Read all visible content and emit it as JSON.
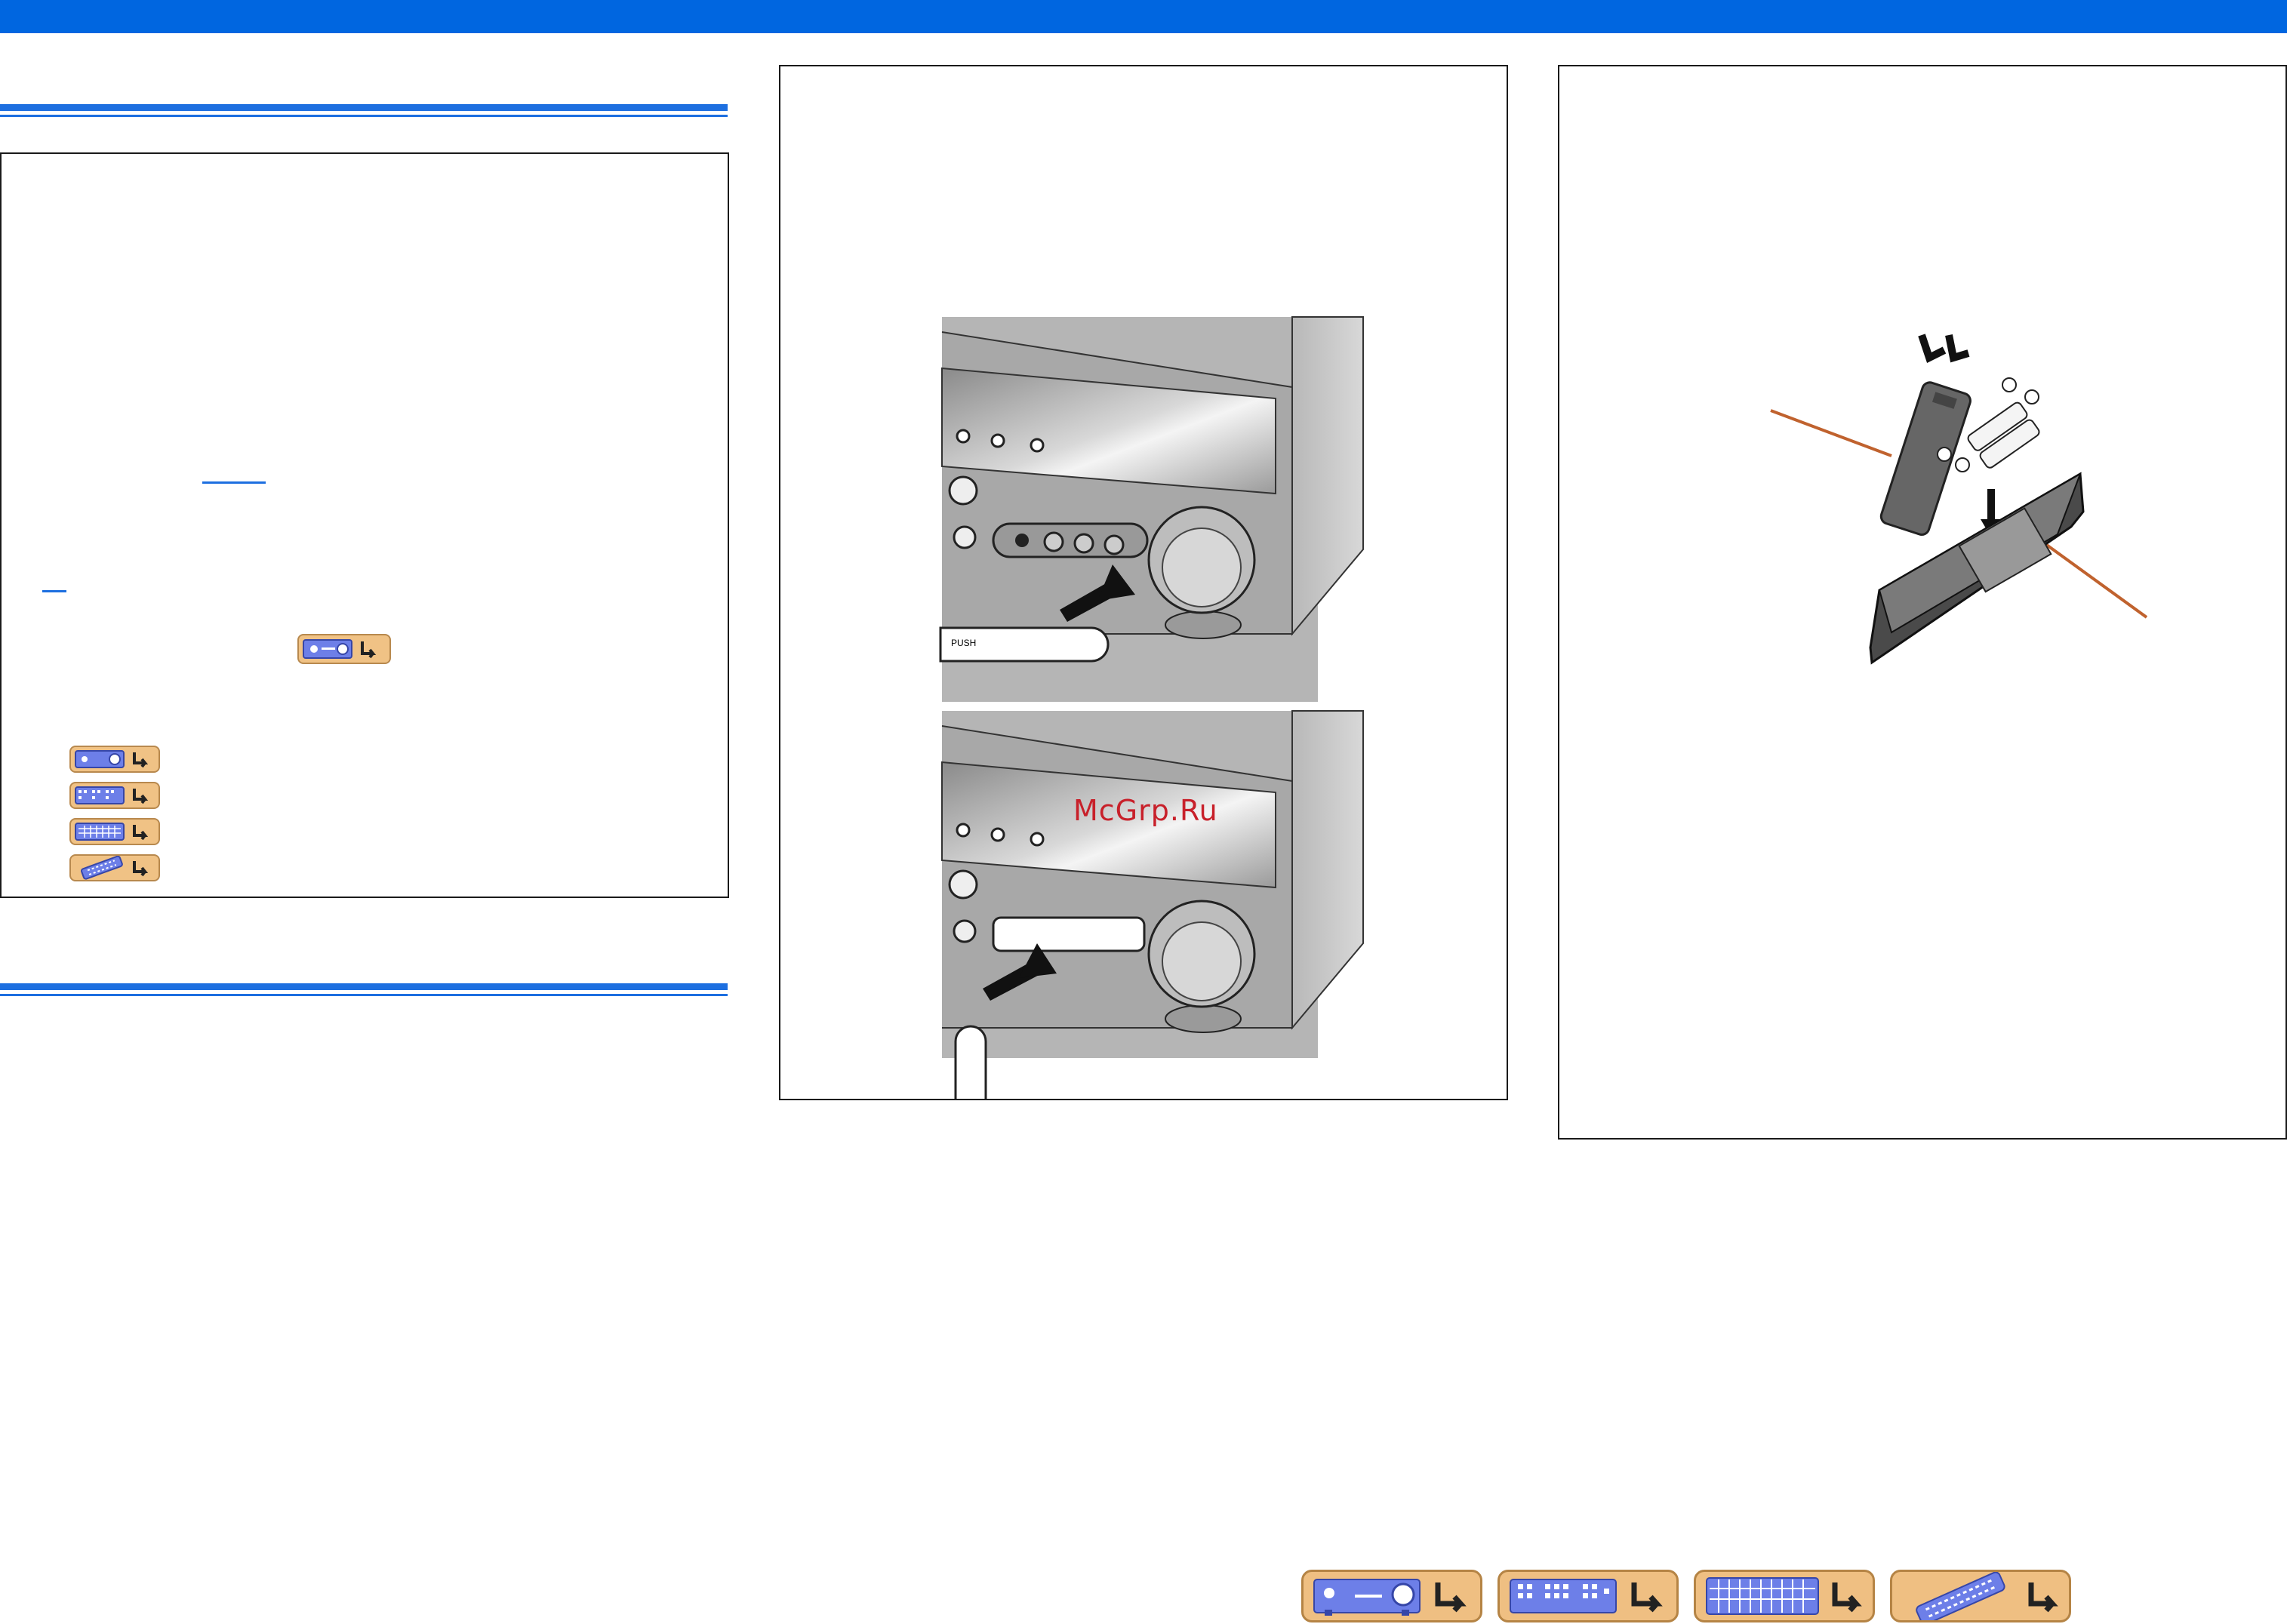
{
  "watermark": "McGrp.Ru",
  "front_panel": {
    "push_label": "PUSH"
  },
  "nav_bar": {
    "items": [
      {
        "icon": "receiver-front-panel-icon"
      },
      {
        "icon": "receiver-rear-panel-icon"
      },
      {
        "icon": "remote-control-keypad-icon"
      },
      {
        "icon": "remote-control-icon"
      }
    ]
  },
  "colors": {
    "header_bar": "#0066e0",
    "accent_rule": "#1d6fe0",
    "nav_button": "#efbf82",
    "callout_line": "#c0622e"
  }
}
